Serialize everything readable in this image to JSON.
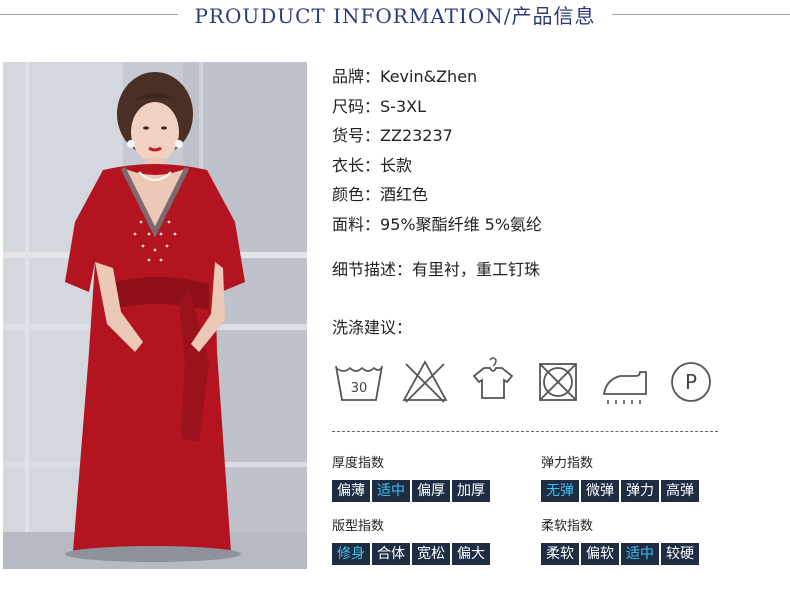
{
  "header": {
    "title": "PROUDUCT INFORMATION/产品信息"
  },
  "product": {
    "image_alt": "红色连衣裙模特照片",
    "info": [
      {
        "label": "品牌：",
        "value": "Kevin&Zhen"
      },
      {
        "label": "尺码：",
        "value": "S-3XL"
      },
      {
        "label": "货号：",
        "value": "ZZ23237"
      },
      {
        "label": "衣长：",
        "value": "长款"
      },
      {
        "label": "颜色：",
        "value": "酒红色"
      },
      {
        "label": "面料：",
        "value": "95%聚酯纤维 5%氨纶"
      }
    ],
    "detail": {
      "label": "细节描述：",
      "value": "有里衬，重工钉珠"
    }
  },
  "wash": {
    "title": "洗涤建议：",
    "icons": [
      {
        "name": "wash-30-icon",
        "text": "30"
      },
      {
        "name": "no-bleach-icon"
      },
      {
        "name": "hang-dry-icon"
      },
      {
        "name": "no-tumble-dry-icon"
      },
      {
        "name": "iron-icon"
      },
      {
        "name": "dry-clean-p-icon",
        "text": "P"
      }
    ]
  },
  "indices": [
    {
      "title": "厚度指数",
      "options": [
        "偏薄",
        "适中",
        "偏厚",
        "加厚"
      ],
      "selected": 1
    },
    {
      "title": "弹力指数",
      "options": [
        "无弹",
        "微弹",
        "弹力",
        "高弹"
      ],
      "selected": 0
    },
    {
      "title": "版型指数",
      "options": [
        "修身",
        "合体",
        "宽松",
        "偏大"
      ],
      "selected": 0
    },
    {
      "title": "柔软指数",
      "options": [
        "柔软",
        "偏软",
        "适中",
        "较硬"
      ],
      "selected": 2
    }
  ],
  "colors": {
    "title": "#2c3c78",
    "chip_bg": "#1f2d44",
    "chip_active_text": "#3cc1f0",
    "dress": "#b3141f"
  }
}
